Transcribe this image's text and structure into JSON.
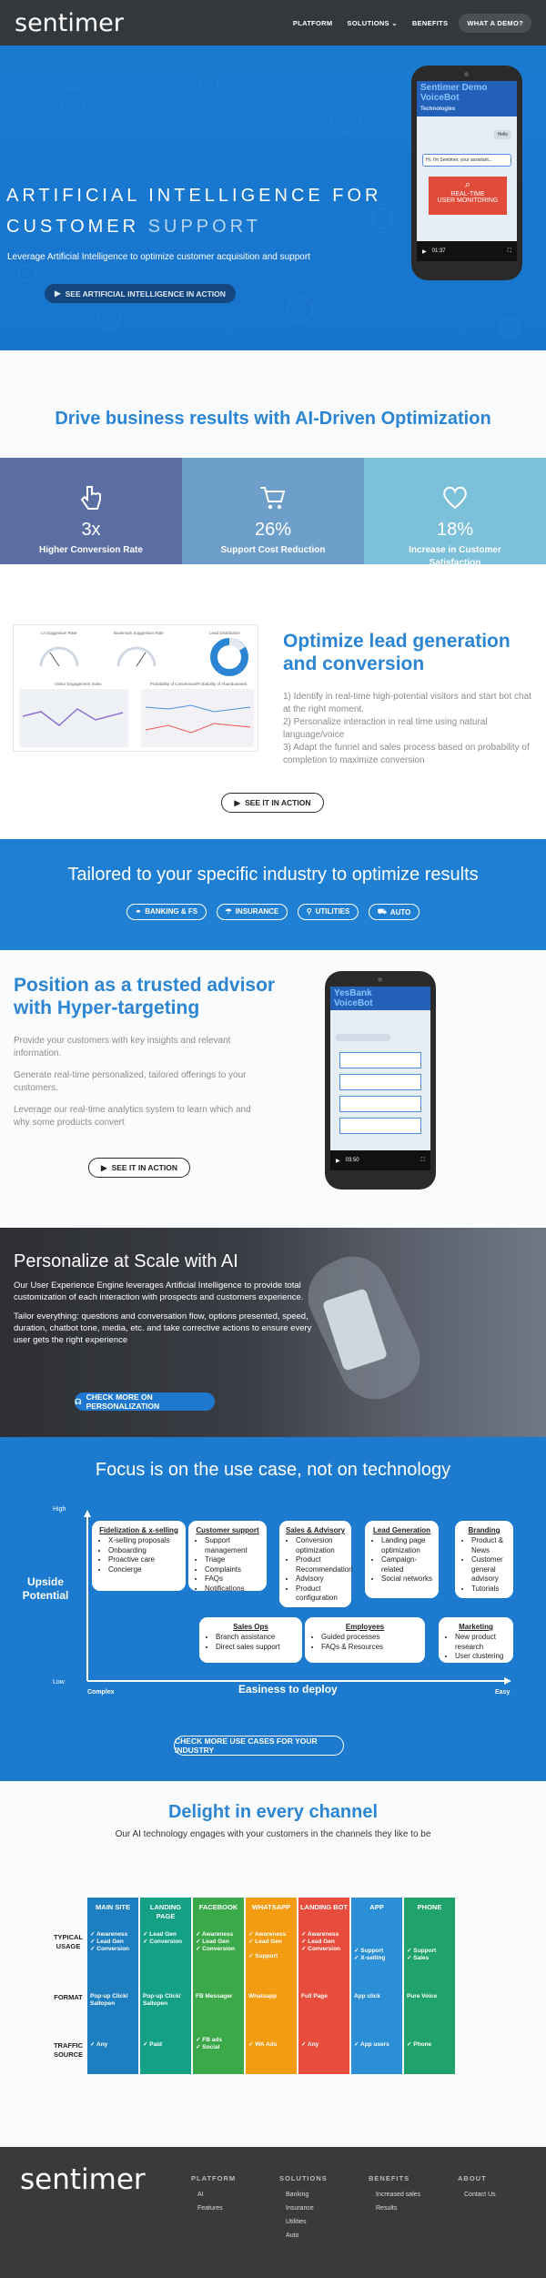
{
  "header": {
    "logo": "sentimer",
    "nav": [
      "PLATFORM",
      "SOLUTIONS",
      "BENEFITS",
      "WHAT A DEMO?"
    ],
    "solutions_caret": "⌄"
  },
  "hero": {
    "line1": "ARTIFICIAL INTELLIGENCE FOR",
    "line2a": "CUSTOMER",
    "line2b": "SUPPORT",
    "sub": "Leverage Artificial Intelligence to optimize customer acquisition and support",
    "cta": "SEE ARTIFICIAL INTELLIGENCE IN ACTION",
    "phone": {
      "banner1": "Sentimer Demo",
      "banner2": "VoiceBot",
      "chip1": "Technologies",
      "bubble": "Hello",
      "bubble2": "Hi, I'm Sentimer, your assistant...",
      "red_line1": "REAL-TIME",
      "red_line2": "USER MONITORING",
      "time": "01:37"
    }
  },
  "drive": {
    "title": "Drive business results with AI-Driven Optimization",
    "stats": [
      {
        "value": "3x",
        "label": "Higher Conversion Rate",
        "color": "#5b6ea3",
        "icon": "hand-pointer-icon"
      },
      {
        "value": "26%",
        "label": "Support Cost Reduction",
        "color": "#6d9fca",
        "icon": "cart-icon"
      },
      {
        "value": "18%",
        "label": "Increase in Customer Satisfaction",
        "color": "#7cc0d9",
        "icon": "heart-icon"
      }
    ]
  },
  "optimize": {
    "title1": "Optimize lead generation",
    "title2": "and conversion",
    "p1": "1) Identify in real-time high-potential visitors and start bot chat at the right moment.",
    "p2": "2) Personalize interaction in real time using natural language/voice",
    "p3": "3) Adapt the funnel and sales process based on probability of completion to maximize conversion",
    "cta": "SEE IT IN ACTION",
    "dash": {
      "g1": "Lit Suggestion Rate",
      "g2": "Bookmark Suggestion Rate",
      "g3": "Lead Distribution",
      "c1": "Visitor Engagement Index",
      "c2": "Probability of Conversion/Probability of Abandonment"
    }
  },
  "industry": {
    "title": "Tailored to your specific industry to optimize results",
    "tags": [
      "BANKING & FS",
      "INSURANCE",
      "UTILITIES",
      "AUTO"
    ]
  },
  "advisor": {
    "title1": "Position as a trusted advisor",
    "title2": "with Hyper-targeting",
    "p1": "Provide your customers with key insights and relevant information.",
    "p2": "Generate real-time personalized, tailored offerings to your customers.",
    "p3": "Leverage our real-time analytics system to learn which and why some products convert",
    "cta": "SEE IT IN ACTION",
    "phone": {
      "banner1": "YesBank",
      "banner2": "VoiceBot",
      "time": "03:50"
    }
  },
  "personalize": {
    "title": "Personalize at Scale with AI",
    "p1": "Our User Experience Engine leverages Artificial Intelligence to provide total customization of each interaction with prospects and customers experience.",
    "p2": "Tailor everything: questions and conversation flow, options presented, speed, duration, chatbot tone, media, etc. and take corrective actions to ensure every user gets the right experience",
    "cta": "CHECK MORE ON PERSONALIZATION"
  },
  "focus": {
    "title": "Focus is on the use case, not on technology",
    "y_label": "Upside Potential",
    "y_high": "High",
    "y_low": "Low",
    "x_label": "Easiness to deploy",
    "x_left": "Complex",
    "x_right": "Easy",
    "cards": [
      {
        "title": "Fidelization & x-selling",
        "items": [
          "X-selling proposals",
          "Onboarding",
          "Proactive care",
          "Concierge"
        ]
      },
      {
        "title": "Customer support",
        "items": [
          "Support management",
          "Triage",
          "Complaints",
          "FAQs",
          "Notifications"
        ]
      },
      {
        "title": "Sales & Advisory",
        "items": [
          "Conversion optimization",
          "Product Recommendation",
          "Advisory",
          "Product configuration"
        ]
      },
      {
        "title": "Lead Generation",
        "items": [
          "Landing page optimization",
          "Campaign-related",
          "Social networks"
        ]
      },
      {
        "title": "Branding",
        "items": [
          "Product & News",
          "Customer general advisory",
          "Tutorials"
        ]
      },
      {
        "title": "Sales Ops",
        "items": [
          "Branch assistance",
          "Direct sales support"
        ]
      },
      {
        "title": "Employees",
        "items": [
          "Guided processes",
          "FAQs & Resources"
        ]
      },
      {
        "title": "Marketing",
        "items": [
          "New product research",
          "User clustering"
        ]
      }
    ],
    "cta": "CHECK MORE USE CASES FOR YOUR INDUSTRY"
  },
  "channels": {
    "title": "Delight in every channel",
    "sub": "Our AI technology engages with your customers in the channels they like to be",
    "rows": [
      "TYPICAL USAGE",
      "FORMAT",
      "TRAFFIC SOURCE"
    ],
    "cols": [
      {
        "head": "MAIN SITE",
        "color": "#1d7fbf",
        "usage": [
          "Awareness",
          "Lead Gen",
          "Conversion"
        ],
        "format": "Pop-up Click/ Sallopen",
        "traffic": [
          "Any"
        ]
      },
      {
        "head": "LANDING PAGE",
        "color": "#14a085",
        "usage": [
          "Lead Gen",
          "Conversion"
        ],
        "format": "Pop-up Click/ Sallopen",
        "traffic": [
          "Paid"
        ]
      },
      {
        "head": "FACEBOOK",
        "color": "#3ba849",
        "usage": [
          "Awareness",
          "Lead Gen",
          "Conversion"
        ],
        "format": "FB Messager",
        "traffic": [
          "FB ads",
          "Social"
        ]
      },
      {
        "head": "WHATSAPP",
        "color": "#f39c12",
        "usage": [
          "Awareness",
          "Lead Gen",
          "Support"
        ],
        "format": "Whatsapp",
        "traffic": [
          "WA Ads"
        ]
      },
      {
        "head": "LANDING BOT",
        "color": "#e74c3c",
        "usage": [
          "Awareness",
          "Lead Gen",
          "Conversion"
        ],
        "format": "Full Page",
        "traffic": [
          "Any"
        ]
      },
      {
        "head": "APP",
        "color": "#2b8fd6",
        "usage": [
          "Support",
          "X-selling"
        ],
        "format": "App click",
        "traffic": [
          "App users"
        ]
      },
      {
        "head": "PHONE",
        "color": "#1fa36b",
        "usage": [
          "Support",
          "Sales"
        ],
        "format": "Pure Voice",
        "traffic": [
          "Phone"
        ]
      }
    ]
  },
  "footer": {
    "logo": "sentimer",
    "cols": [
      {
        "title": "PLATFORM",
        "links": [
          "AI",
          "Features"
        ]
      },
      {
        "title": "SOLUTIONS",
        "links": [
          "Banking",
          "Insurance",
          "Utilities",
          "Auto"
        ]
      },
      {
        "title": "BENEFITS",
        "links": [
          "Increased sales",
          "Results"
        ]
      },
      {
        "title": "ABOUT",
        "links": [
          "Contact Us"
        ]
      }
    ]
  }
}
